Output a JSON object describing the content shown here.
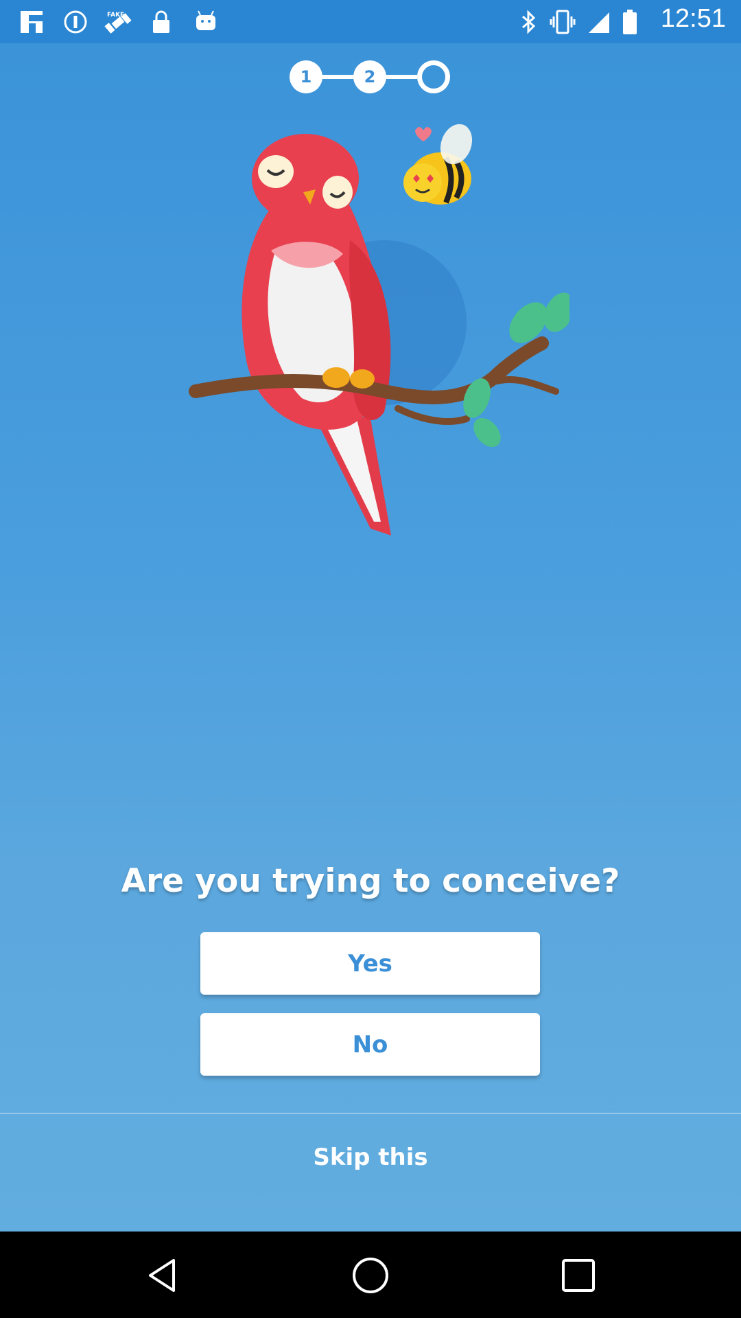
{
  "status_bar": {
    "time": "12:51",
    "icons": [
      "flipboard-icon",
      "info-icon",
      "fake-gps-icon",
      "lock-icon",
      "android-icon",
      "bluetooth-icon",
      "vibrate-icon",
      "signal-icon",
      "battery-icon"
    ]
  },
  "stepper": {
    "steps": [
      "1",
      "2",
      ""
    ]
  },
  "question": {
    "title": "Are you trying to conceive?"
  },
  "answers": {
    "yes_label": "Yes",
    "no_label": "No"
  },
  "skip": {
    "label": "Skip this"
  },
  "nav": {
    "icons": [
      "back-icon",
      "home-icon",
      "recents-icon"
    ]
  },
  "colors": {
    "accent": "#3b8fd7",
    "background_top": "#3a92d8",
    "background_bottom": "#62addf"
  }
}
